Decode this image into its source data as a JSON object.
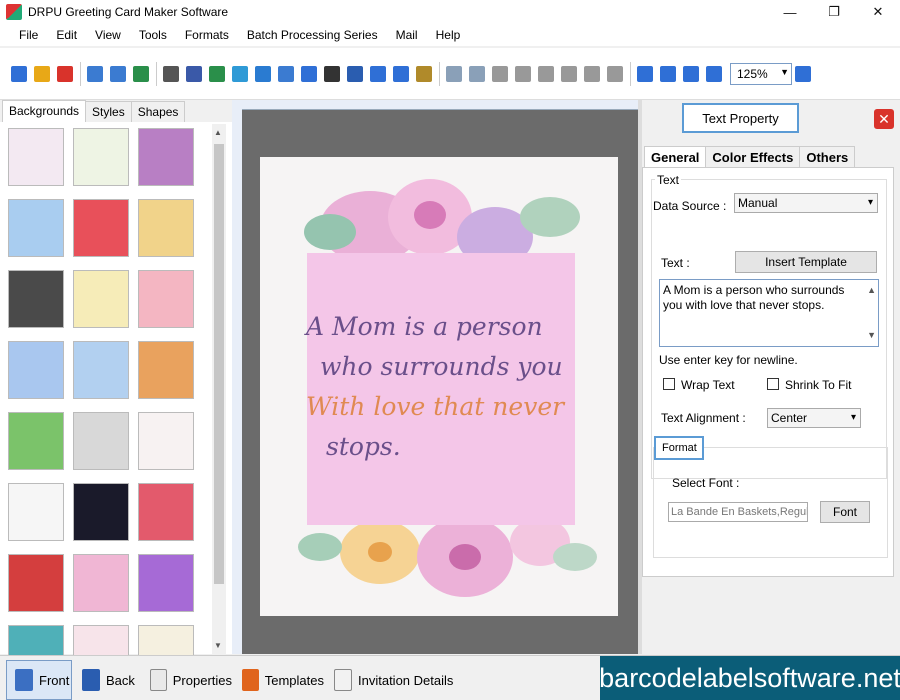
{
  "window": {
    "title": "DRPU Greeting Card Maker Software",
    "controls": {
      "minimize": "—",
      "restore": "❐",
      "close": "✕"
    }
  },
  "menu": [
    "File",
    "Edit",
    "View",
    "Tools",
    "Formats",
    "Batch Processing Series",
    "Mail",
    "Help"
  ],
  "toolbar": {
    "zoom_value": "125%",
    "icons": [
      "new-icon",
      "open-icon",
      "close-icon",
      "save-icon",
      "save-as-icon",
      "export-icon",
      "print-icon",
      "print-preview-icon",
      "image-icon",
      "picture-icon",
      "pencil-icon",
      "shape-icon",
      "text-icon",
      "barcode-icon",
      "art-text-icon",
      "signature-icon",
      "line-icon",
      "database-icon",
      "undo-icon",
      "redo-icon",
      "cut-icon",
      "copy-icon",
      "paste-icon",
      "delete-icon",
      "bring-front-icon",
      "send-back-icon",
      "grid-icon",
      "actual-size-icon",
      "fit-icon",
      "zoom-in-icon",
      "zoom-out-icon"
    ]
  },
  "left_panel": {
    "tabs": [
      "Backgrounds",
      "Styles",
      "Shapes"
    ],
    "active_tab": "Backgrounds",
    "thumbnails": [
      "#f3e9f2",
      "#eef4e4",
      "#b87fc4",
      "#a9cdf0",
      "#e8505a",
      "#f1d38a",
      "#4a4a4a",
      "#f6ecb8",
      "#f4b6c2",
      "#a9c7ef",
      "#b2d0f0",
      "#e9a25e",
      "#7bc36a",
      "#d8d8d8",
      "#f7f2f2",
      "#f6f6f6",
      "#1a1a2a",
      "#e35a6c",
      "#d43e3e",
      "#f0b6d4",
      "#a66ad6",
      "#4fb0b8",
      "#f7e4ea",
      "#f5f0e0"
    ]
  },
  "card": {
    "line1": "A Mom is a person",
    "line2": "who surrounds you",
    "line3": "With love that never",
    "line4": "stops."
  },
  "right_panel": {
    "title": "Text Property",
    "close_label": "✕",
    "tabs": [
      "General",
      "Color Effects",
      "Others"
    ],
    "active_tab": "General",
    "group_text": "Text",
    "data_source_label": "Data Source :",
    "data_source_value": "Manual",
    "text_label": "Text :",
    "insert_template_label": "Insert Template",
    "text_value": "A Mom is a person who surrounds you with love that never stops.",
    "newline_hint": "Use enter key for newline.",
    "wrap_text_label": "Wrap Text",
    "shrink_to_fit_label": "Shrink To Fit",
    "text_alignment_label": "Text Alignment :",
    "text_alignment_value": "Center",
    "format_title": "Format",
    "select_font_label": "Select Font :",
    "font_value": "La Bande En Baskets,Regul",
    "font_button_label": "Font"
  },
  "bottom_bar": {
    "buttons": [
      "Front",
      "Back",
      "Properties",
      "Templates",
      "Invitation Details"
    ],
    "active": "Front",
    "brand": "barcodelabelsoftware.net"
  }
}
